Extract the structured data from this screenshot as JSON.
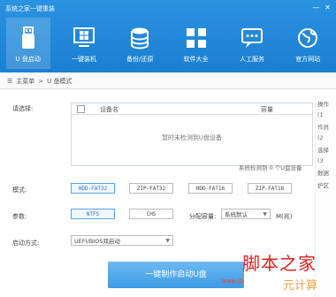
{
  "app": {
    "title": "系统之家一键重装",
    "controls": [
      "—",
      "✕"
    ]
  },
  "nav": [
    {
      "label": "U 盘启动",
      "icon": "usb-drive-icon"
    },
    {
      "label": "一键装机",
      "icon": "windows-logo-icon"
    },
    {
      "label": "备份/还原",
      "icon": "database-icon"
    },
    {
      "label": "软件大全",
      "icon": "apps-grid-icon"
    },
    {
      "label": "人工服务",
      "icon": "chat-bubble-icon"
    },
    {
      "label": "官方网站",
      "icon": "globe-icon"
    }
  ],
  "breadcrumb": {
    "home": "主菜单",
    "separator": ">",
    "current": "U 盘模式"
  },
  "device": {
    "label": "请选择:",
    "col_name": "设备名",
    "col_capacity": "容量",
    "empty_text": "暂时未检测到U盘设备",
    "status": "系统检测到 0 个U盘设备"
  },
  "mode": {
    "label": "模式:",
    "options": [
      "HDD-FAT32",
      "ZIP-FAT32",
      "HDD-FAT16",
      "ZIP-FAT16"
    ],
    "selected_index": 0
  },
  "params": {
    "label": "参数:",
    "options": [
      "NTFS",
      "CHS"
    ],
    "selected_index": 0,
    "partition_label": "分配容量:",
    "partition_value": "系统默认",
    "partition_unit": "M(兆)"
  },
  "boot": {
    "label": "启动方式:",
    "value": "UEFI/BIOS双启动"
  },
  "action": {
    "make_label": "一键制作启动U盘"
  },
  "right_panel": {
    "title": "操作",
    "items": [
      "(1",
      "作员",
      "(2",
      "选择",
      "(3",
      "数据",
      "护区"
    ]
  },
  "watermark": {
    "title": "脚本之家",
    "url": "www.jb",
    "sub": "元计算"
  }
}
